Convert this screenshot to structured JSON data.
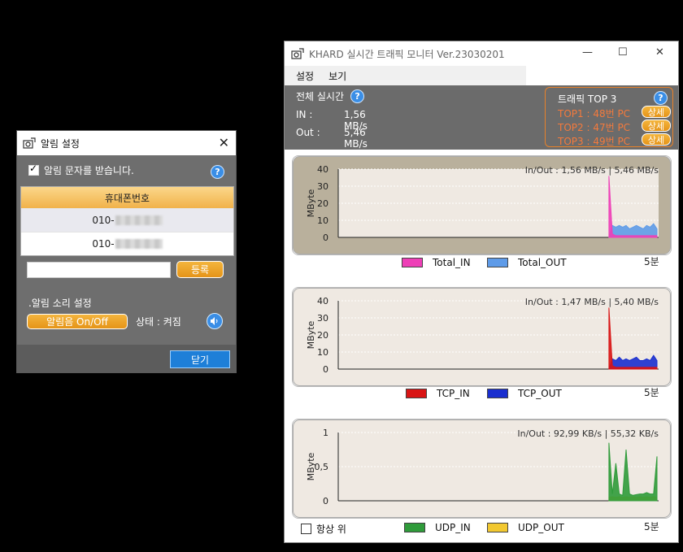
{
  "alarm_dialog": {
    "title": "알림 설정",
    "receive_sms_label": "알림 문자를 받습니다.",
    "receive_sms_checked": true,
    "help": "?",
    "phone_header": "휴대폰번호",
    "phones": [
      "010-",
      "010-"
    ],
    "input_value": "",
    "register_button": "등록",
    "sound_label": ".알림 소리 설정",
    "toggle_button": "알림음 On/Off",
    "status_text": "상태 : 켜짐",
    "close_button": "닫기",
    "close_icon": "✕"
  },
  "main_window": {
    "title": "KHARD 실시간 트래픽 모니터 Ver.23030201",
    "menu": [
      "설정",
      "보기"
    ],
    "total_label": "전체 실시간",
    "in_label": "IN :",
    "in_value": "1,56 MB/s",
    "out_label": "Out :",
    "out_value": "5,46 MB/s",
    "top3_title": "트래픽 TOP 3",
    "top3": [
      {
        "label": "TOP1 :  48번 PC",
        "button": "상세"
      },
      {
        "label": "TOP2 :  47번 PC",
        "button": "상세"
      },
      {
        "label": "TOP3 :  49번 PC",
        "button": "상세"
      }
    ],
    "always_on_top_label": "항상 위",
    "always_on_top_checked": false
  },
  "colors": {
    "accent_orange": "#f0a53a",
    "title_blue": "#1e7fd8",
    "top3_orange": "#f47a3c"
  },
  "chart_data": [
    {
      "type": "area",
      "title": "In/Out : 1,56 MB/s | 5,46 MB/s",
      "ylabel": "MByte",
      "yticks": [
        "40",
        "30",
        "20",
        "10",
        "0"
      ],
      "ylim": [
        0,
        40
      ],
      "time_span": "5분",
      "background": "#b9b09c",
      "series": [
        {
          "name": "Total_IN",
          "color": "#ee3fb7",
          "values": [
            36,
            2,
            1,
            1,
            1,
            1,
            1,
            1,
            1,
            1,
            1,
            1,
            1,
            1,
            1
          ]
        },
        {
          "name": "Total_OUT",
          "color": "#5e9be8",
          "values": [
            0,
            7,
            6,
            7,
            6,
            7,
            5,
            6,
            7,
            6,
            5,
            7,
            6,
            8,
            5
          ]
        }
      ]
    },
    {
      "type": "area",
      "title": "In/Out : 1,47 MB/s | 5,40 MB/s",
      "ylabel": "MByte",
      "yticks": [
        "40",
        "30",
        "20",
        "10",
        "0"
      ],
      "ylim": [
        0,
        40
      ],
      "time_span": "5분",
      "background": "#efe9e2",
      "series": [
        {
          "name": "TCP_IN",
          "color": "#d81414",
          "values": [
            36,
            2,
            1,
            1,
            1,
            1,
            1,
            1,
            1,
            1,
            1,
            1,
            1,
            1,
            1
          ]
        },
        {
          "name": "TCP_OUT",
          "color": "#1a2fcf",
          "values": [
            0,
            6,
            5,
            7,
            5,
            6,
            5,
            6,
            7,
            5,
            5,
            6,
            5,
            8,
            5
          ]
        }
      ]
    },
    {
      "type": "area",
      "title": "In/Out : 92,99 KB/s | 55,32 KB/s",
      "ylabel": "MByte",
      "yticks": [
        "1",
        "0,5",
        "0"
      ],
      "ylim": [
        0,
        1
      ],
      "time_span": "5분",
      "background": "#efe9e2",
      "series": [
        {
          "name": "UDP_IN",
          "color": "#2f9b3a",
          "values": [
            0.85,
            0.1,
            0.55,
            0.1,
            0.08,
            0.75,
            0.1,
            0.08,
            0.09,
            0.1,
            0.1,
            0.12,
            0.1,
            0.1,
            0.65
          ]
        },
        {
          "name": "UDP_OUT",
          "color": "#f2c830",
          "values": [
            0.05,
            0.06,
            0.05,
            0.06,
            0.05,
            0.06,
            0.05,
            0.06,
            0.05,
            0.06,
            0.05,
            0.06,
            0.05,
            0.06,
            0.05
          ]
        }
      ]
    }
  ]
}
